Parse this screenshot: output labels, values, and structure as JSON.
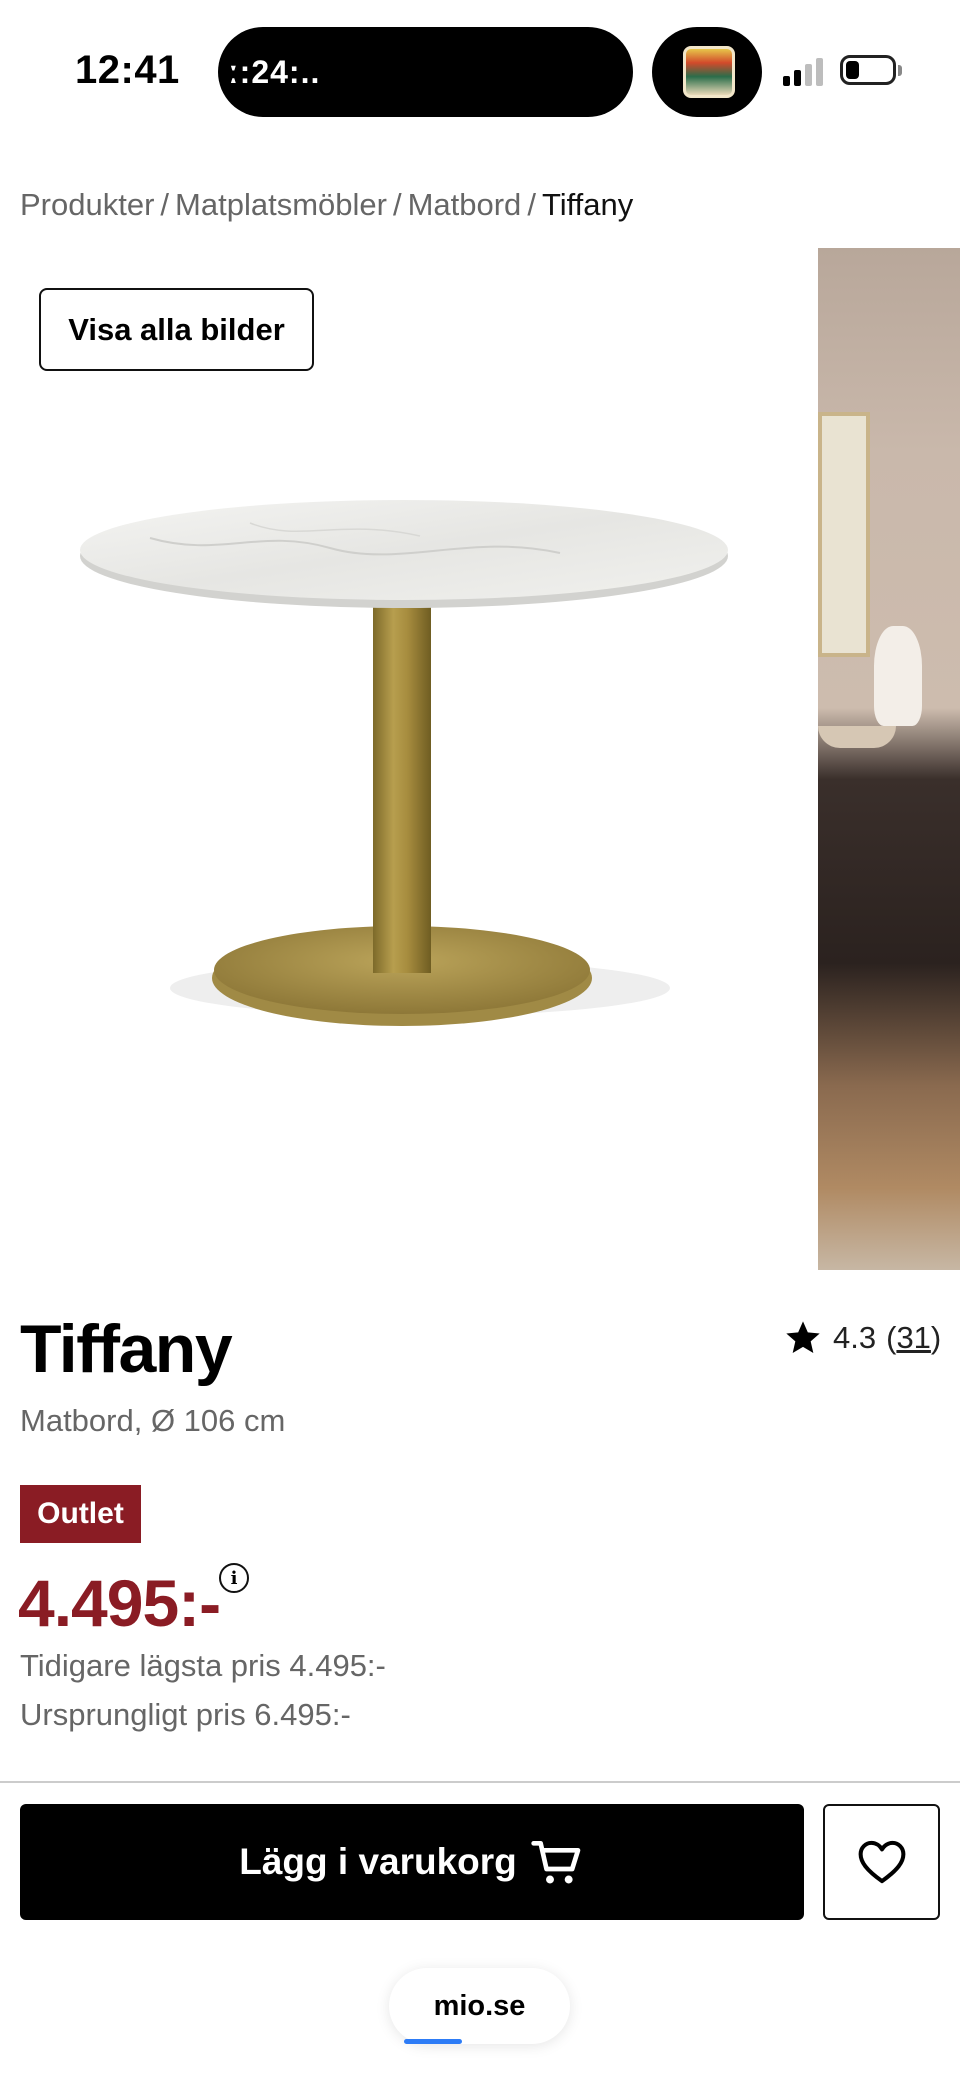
{
  "status_bar": {
    "time": "12:41",
    "island_text": "ː:24:..",
    "signal_bars": 4,
    "signal_active": 2,
    "battery_level": 0.2
  },
  "breadcrumb": {
    "items": [
      "Produkter",
      "Matplatsmöbler",
      "Matbord"
    ],
    "current": "Tiffany",
    "separator": "/"
  },
  "gallery": {
    "show_all_label": "Visa alla bilder"
  },
  "product": {
    "title": "Tiffany",
    "subtitle": "Matbord, Ø 106 cm",
    "rating_value": "4.3",
    "rating_count_open": "(",
    "rating_count": "31",
    "rating_count_close": ")",
    "badge": "Outlet",
    "price": "4.495:-",
    "info_icon_glyph": "i",
    "previous_lowest_price": "Tidigare lägsta pris 4.495:-",
    "original_price": "Ursprungligt pris 6.495:-"
  },
  "actions": {
    "add_to_cart_label": "Lägg i varukorg"
  },
  "browser": {
    "url": "mio.se"
  },
  "colors": {
    "accent_price": "#8a1c24",
    "badge_bg": "#8a1c24",
    "cart_button_bg": "#000000",
    "load_bar": "#2d7cf6"
  },
  "icons": {
    "rating": "star-icon",
    "cart": "cart-icon",
    "wishlist": "heart-icon",
    "info": "info-icon"
  }
}
